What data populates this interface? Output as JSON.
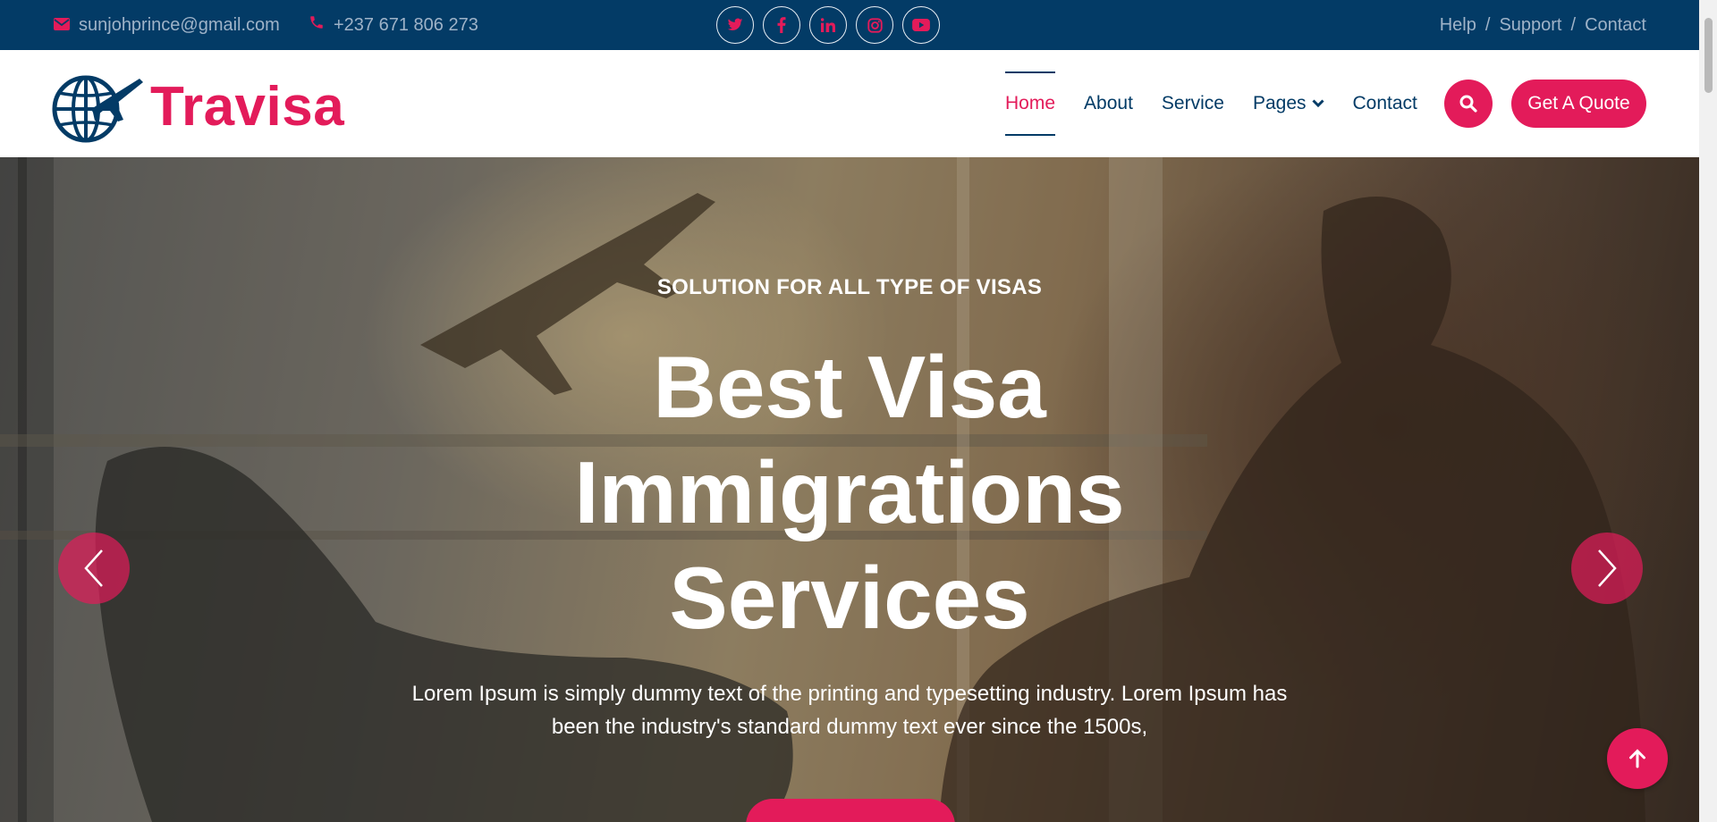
{
  "topbar": {
    "email": "sunjohprince@gmail.com",
    "phone": "+237 671 806 273",
    "socials": [
      "twitter-icon",
      "facebook-icon",
      "linkedin-icon",
      "instagram-icon",
      "youtube-icon"
    ],
    "links": [
      "Help",
      "Support",
      "Contact"
    ],
    "separator": "/"
  },
  "brand": {
    "name": "Travisa",
    "color": "#e31b5a",
    "navy": "#033b66"
  },
  "nav": {
    "items": [
      {
        "label": "Home",
        "active": true
      },
      {
        "label": "About"
      },
      {
        "label": "Service"
      },
      {
        "label": "Pages"
      },
      {
        "label": "Contact"
      }
    ],
    "quote_label": "Get A Quote"
  },
  "hero": {
    "subtitle": "SOLUTION FOR ALL TYPE OF VISAS",
    "title_line1": "Best Visa",
    "title_line2": "Immigrations",
    "title_line3": "Services",
    "text_line1": "Lorem Ipsum is simply dummy text of the printing and typesetting industry. Lorem Ipsum has",
    "text_line2": "been the industry's standard dummy text ever since the 1500s,"
  }
}
